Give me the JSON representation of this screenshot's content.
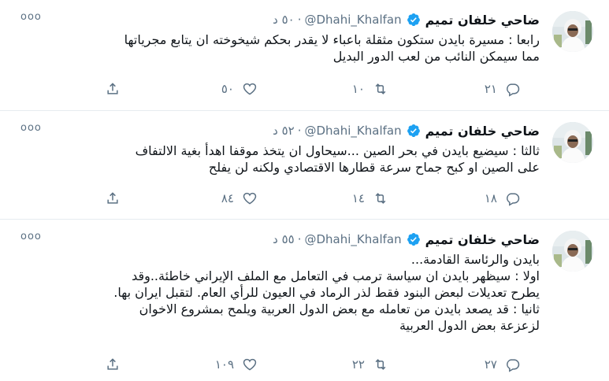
{
  "author": {
    "name": "ضاحي خلفان تميم",
    "handle": "@Dhahi_Khalfan"
  },
  "more_label": "ooo",
  "separator": "·",
  "tweets": [
    {
      "time": "٥٠ د",
      "lines": [
        "رابعا : مسيرة بايدن ستكون مثقلة باعباء لا يقدر بحكم شيخوخته ان يتابع مجرياتها",
        "مما سيمكن النائب من لعب الدور البديل"
      ],
      "replies": "٢١",
      "retweets": "١٠",
      "likes": "٥٠"
    },
    {
      "time": "٥٢ د",
      "lines": [
        "ثالثا : سيضيع بايدن في بحر الصين ...سيحاول ان يتخذ موقفا اهدأ بغية الالتفاف",
        "على الصين او كبح جماح سرعة قطارها الاقتصادي ولكنه لن يفلح"
      ],
      "replies": "١٨",
      "retweets": "١٤",
      "likes": "٨٤"
    },
    {
      "time": "٥٥ د",
      "lines": [
        "بايدن والرئاسة القادمة...",
        "اولا :  سيظهر بايدن ان سياسة ترمب في التعامل مع الملف الإيراني  خاطئة..وقد",
        "يطرح تعديلات لبعض البنود فقط لذر الرماد في العيون للرأي العام. لتقبل ايران بها.",
        "ثانيا : قد يصعد بايدن من تعامله مع بعض الدول العربية ويلمح  بمشروع الاخوان",
        "لزعزعة بعض الدول العربية"
      ],
      "replies": "٢٧",
      "retweets": "٢٢",
      "likes": "١٠٩"
    }
  ],
  "colors": {
    "text": "#0f1419",
    "secondary": "#5b7083",
    "verified": "#1da1f2",
    "divider": "#e6ecf0"
  }
}
